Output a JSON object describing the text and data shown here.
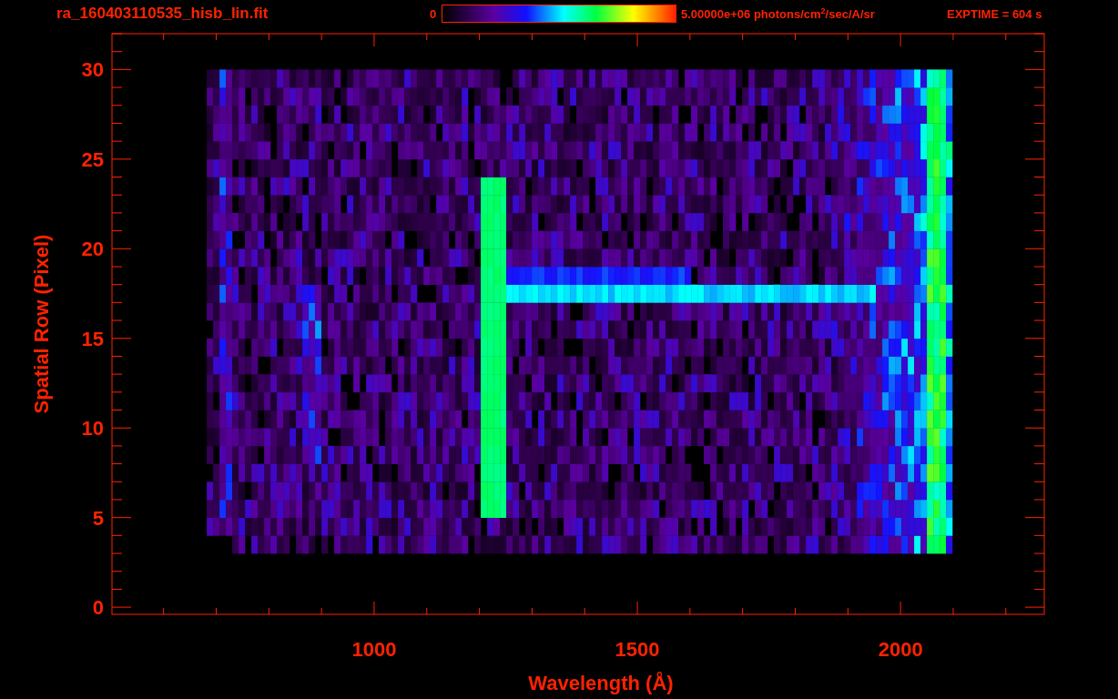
{
  "title": "ra_160403110535_hisb_lin.fit",
  "colorbar": {
    "min_label": "0",
    "max_label": "5.00000e+06 photons/cm$^{2}$/sec/A/sr"
  },
  "exposure": "EXPTIME = 604 s",
  "plot": {
    "xlabel": "Wavelength (Å)",
    "ylabel": "Spatial Row (Pixel)",
    "xticks": [
      "1000",
      "1500",
      "2000"
    ],
    "yticks": [
      "30",
      "25",
      "20",
      "15",
      "10",
      "5",
      "0"
    ]
  }
}
